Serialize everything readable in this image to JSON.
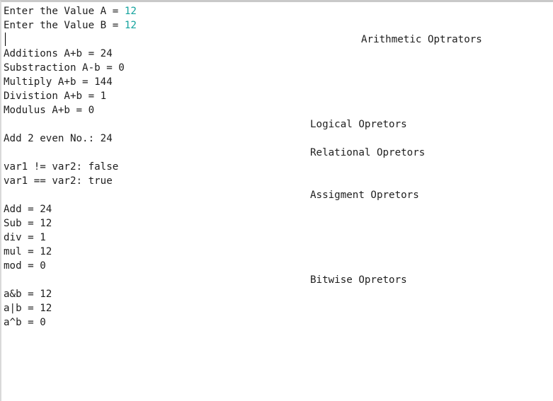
{
  "console": {
    "prompt_a": {
      "label": "Enter the Value A = ",
      "value": "12"
    },
    "prompt_b": {
      "label": "Enter the Value B = ",
      "value": "12"
    },
    "headings": {
      "arithmetic": "Arithmetic Optrators",
      "logical": "Logical Opretors",
      "relational": "Relational Opretors",
      "assignment": "Assigment Opretors",
      "bitwise": "Bitwise Opretors"
    },
    "arithmetic_lines": [
      "Additions A+b = 24",
      "Substraction A-b = 0",
      "Multiply A+b = 144",
      "Divistion A+b = 1",
      "Modulus A+b = 0"
    ],
    "logical_line": "Add 2 even No.: 24",
    "relational_lines": [
      "var1 != var2: false",
      "var1 == var2: true"
    ],
    "assignment_lines": [
      "Add = 24",
      "Sub = 12",
      "div = 1",
      "mul = 12",
      "mod = 0"
    ],
    "bitwise_lines": [
      "a&b = 12",
      "a|b = 12",
      "a^b = 0"
    ]
  }
}
